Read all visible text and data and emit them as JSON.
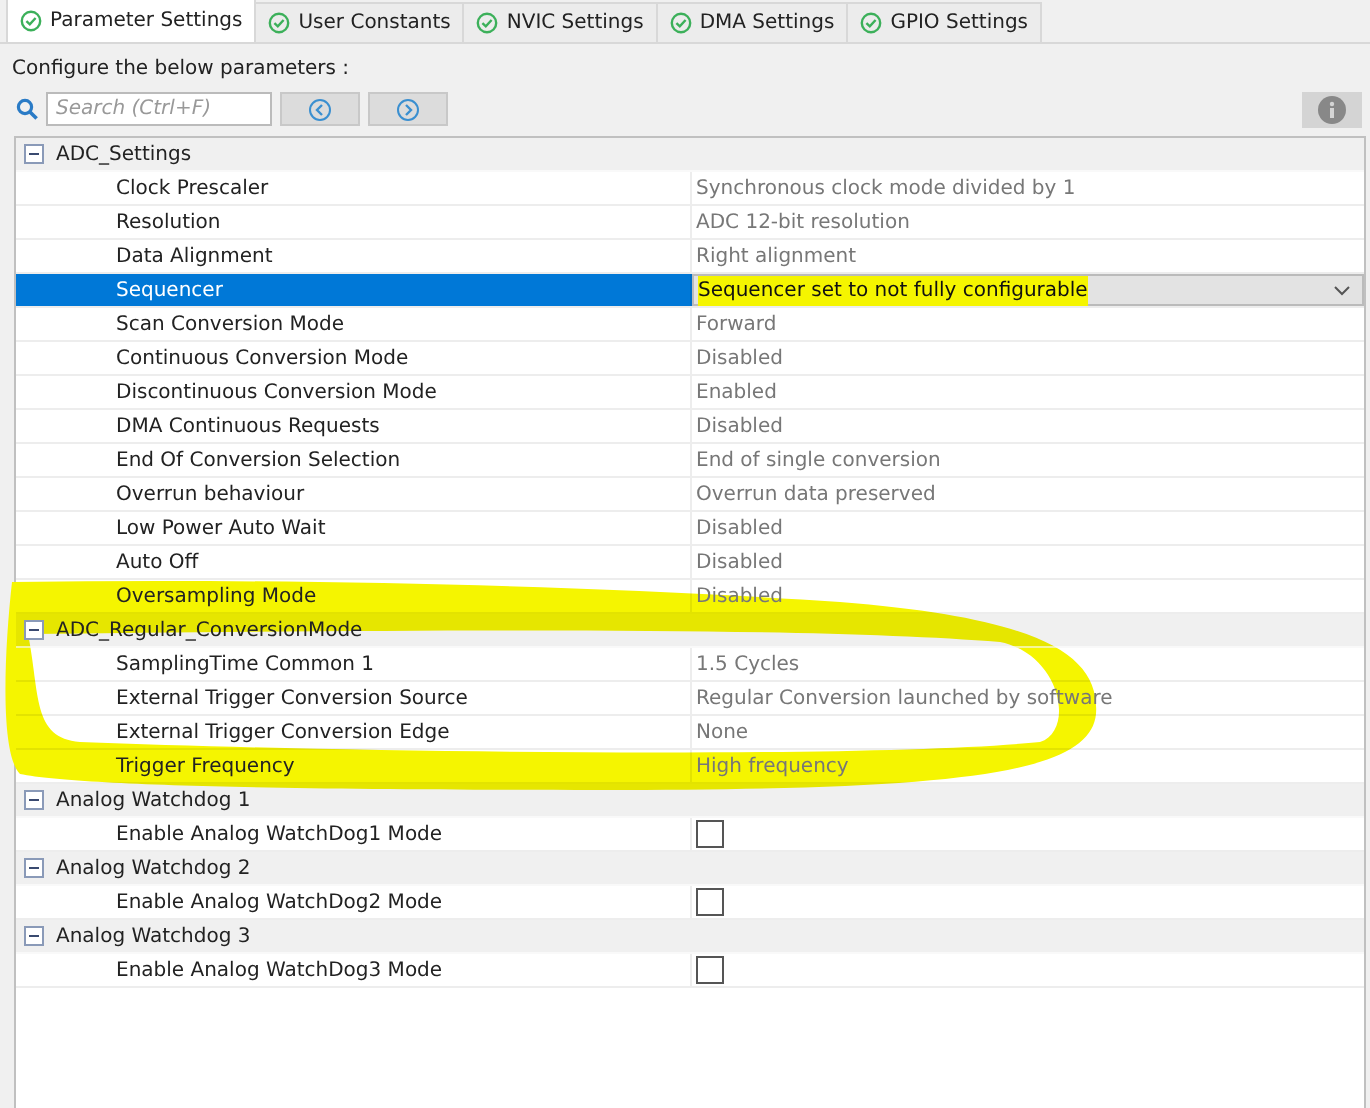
{
  "tabs": [
    {
      "label": "Parameter Settings",
      "selected": true
    },
    {
      "label": "User Constants",
      "selected": false
    },
    {
      "label": "NVIC Settings",
      "selected": false
    },
    {
      "label": "DMA Settings",
      "selected": false
    },
    {
      "label": "GPIO Settings",
      "selected": false
    }
  ],
  "heading": "Configure the below parameters :",
  "search": {
    "placeholder": "Search (Ctrl+F)"
  },
  "groups": [
    {
      "label": "ADC_Settings",
      "expanded": true,
      "rows": [
        {
          "name": "Clock Prescaler",
          "kind": "text",
          "value": "Synchronous clock mode divided by 1",
          "selected": false
        },
        {
          "name": "Resolution",
          "kind": "text",
          "value": "ADC 12-bit resolution",
          "selected": false
        },
        {
          "name": "Data Alignment",
          "kind": "text",
          "value": "Right alignment",
          "selected": false
        },
        {
          "name": "Sequencer",
          "kind": "dropdown",
          "value": "Sequencer set to not fully configurable",
          "selected": true,
          "highlighted": true
        },
        {
          "name": "Scan Conversion Mode",
          "kind": "text",
          "value": "Forward",
          "selected": false
        },
        {
          "name": "Continuous Conversion Mode",
          "kind": "text",
          "value": "Disabled",
          "selected": false
        },
        {
          "name": "Discontinuous Conversion Mode",
          "kind": "text",
          "value": "Enabled",
          "selected": false
        },
        {
          "name": "DMA Continuous Requests",
          "kind": "text",
          "value": "Disabled",
          "selected": false
        },
        {
          "name": "End Of Conversion Selection",
          "kind": "text",
          "value": "End of single conversion",
          "selected": false
        },
        {
          "name": "Overrun behaviour",
          "kind": "text",
          "value": "Overrun data preserved",
          "selected": false
        },
        {
          "name": "Low Power Auto Wait",
          "kind": "text",
          "value": "Disabled",
          "selected": false
        },
        {
          "name": "Auto Off",
          "kind": "text",
          "value": "Disabled",
          "selected": false
        },
        {
          "name": "Oversampling Mode",
          "kind": "text",
          "value": "Disabled",
          "selected": false
        }
      ]
    },
    {
      "label": "ADC_Regular_ConversionMode",
      "expanded": true,
      "rows": [
        {
          "name": "SamplingTime Common 1",
          "kind": "text",
          "value": "1.5 Cycles",
          "selected": false
        },
        {
          "name": "External Trigger Conversion Source",
          "kind": "text",
          "value": "Regular Conversion launched by software",
          "selected": false
        },
        {
          "name": "External Trigger Conversion Edge",
          "kind": "text",
          "value": "None",
          "selected": false
        },
        {
          "name": "Trigger Frequency",
          "kind": "text",
          "value": "High frequency",
          "selected": false
        }
      ]
    },
    {
      "label": "Analog Watchdog 1",
      "expanded": true,
      "rows": [
        {
          "name": "Enable Analog WatchDog1 Mode",
          "kind": "checkbox",
          "checked": false,
          "selected": false
        }
      ]
    },
    {
      "label": "Analog Watchdog 2",
      "expanded": true,
      "rows": [
        {
          "name": "Enable Analog WatchDog2 Mode",
          "kind": "checkbox",
          "checked": false,
          "selected": false
        }
      ]
    },
    {
      "label": "Analog Watchdog 3",
      "expanded": true,
      "rows": [
        {
          "name": "Enable Analog WatchDog3 Mode",
          "kind": "checkbox",
          "checked": false,
          "selected": false
        }
      ]
    }
  ]
}
